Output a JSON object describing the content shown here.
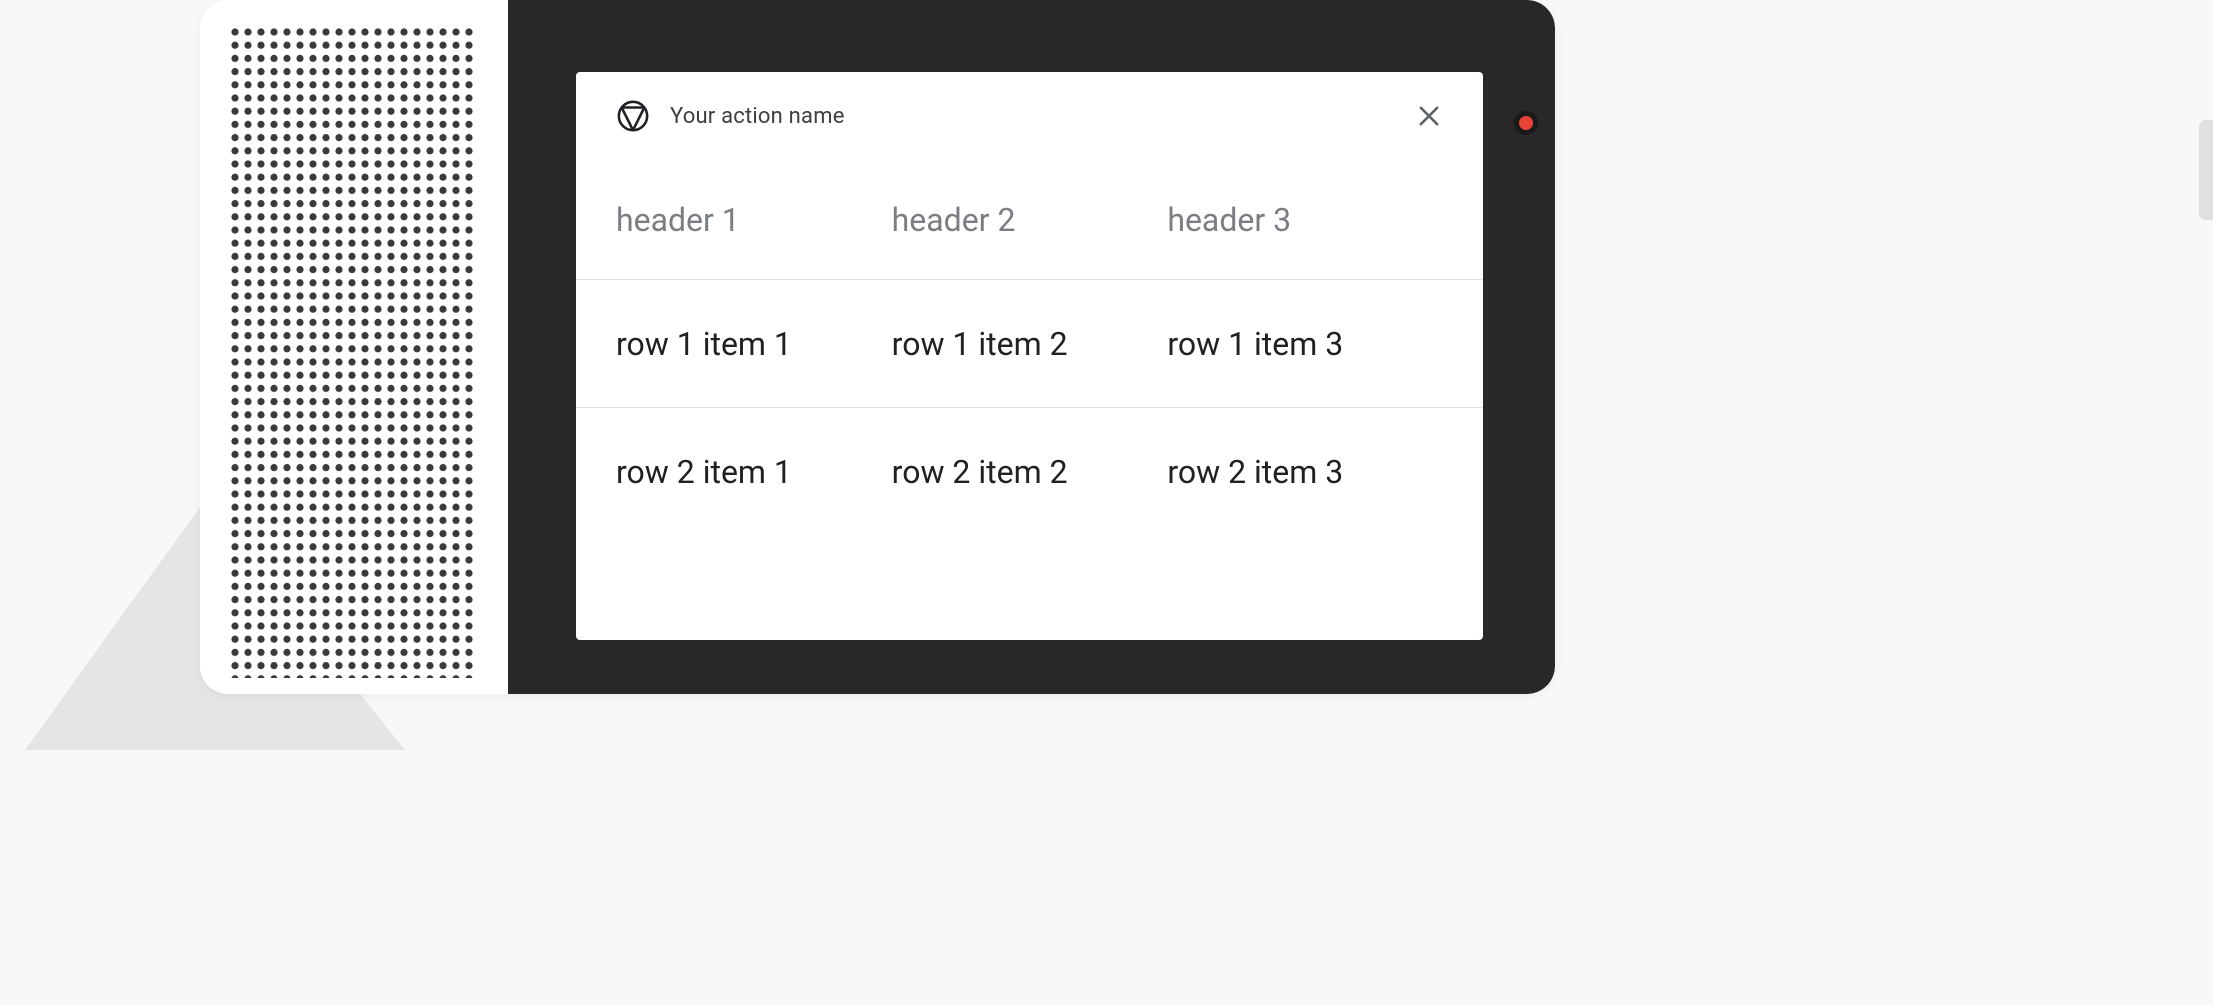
{
  "card": {
    "title": "Your action name",
    "table": {
      "headers": [
        "header 1",
        "header 2",
        "header 3"
      ],
      "rows": [
        [
          "row 1 item 1",
          "row 1 item 2",
          "row 1 item 3"
        ],
        [
          "row 2 item 1",
          "row 2 item 2",
          "row 2 item 3"
        ]
      ]
    }
  }
}
